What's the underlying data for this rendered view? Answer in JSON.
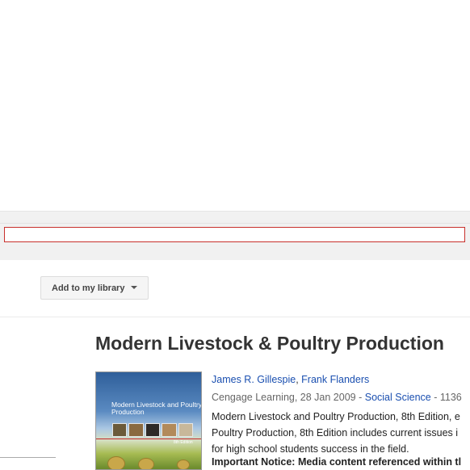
{
  "search": {
    "value": "",
    "placeholder": ""
  },
  "toolbar": {
    "add_to_library_label": "Add to my library"
  },
  "book": {
    "title": "Modern Livestock & Poultry Production",
    "authors": [
      "James R. Gillespie",
      "Frank Flanders"
    ],
    "author_separator": ",",
    "publisher": "Cengage Learning, 28 Jan 2009 - ",
    "category": "Social Science",
    "pages_fragment": " - 1136",
    "description_lines": [
      "Modern Livestock and Poultry Production, 8th Edition, e",
      "Poultry Production, 8th Edition includes current issues i",
      "for high school students success in the field."
    ],
    "notice": "Important Notice: Media content referenced within tl",
    "cover": {
      "title": "Modern Livestock and Poultry Production",
      "edition": "8th Edition"
    }
  },
  "colors": {
    "link": "#1a4fb0",
    "search_border": "#c8302c",
    "title": "#333333"
  }
}
